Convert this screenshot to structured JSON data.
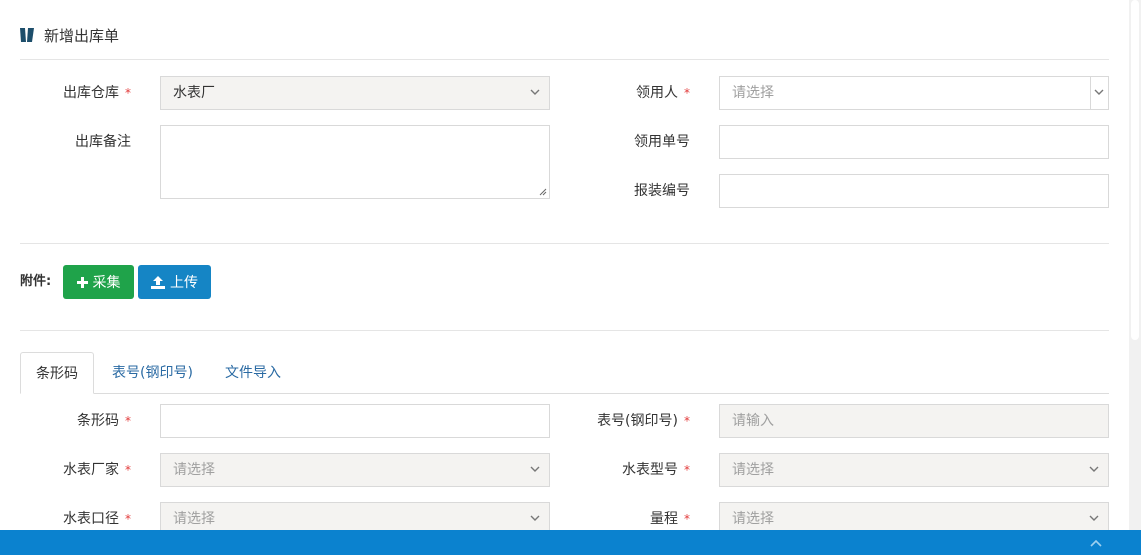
{
  "header": {
    "title": "新增出库单"
  },
  "form": {
    "warehouse": {
      "label": "出库仓库",
      "value": "水表厂"
    },
    "recipient": {
      "label": "领用人",
      "placeholder": "请选择"
    },
    "remark": {
      "label": "出库备注",
      "value": ""
    },
    "requisition_no": {
      "label": "领用单号",
      "value": ""
    },
    "install_no": {
      "label": "报装编号",
      "value": ""
    }
  },
  "attachments": {
    "label": "附件:",
    "collect_label": "采集",
    "upload_label": "上传"
  },
  "tabs": [
    {
      "label": "条形码",
      "active": true
    },
    {
      "label": "表号(钢印号)",
      "active": false
    },
    {
      "label": "文件导入",
      "active": false
    }
  ],
  "tab_form": {
    "barcode": {
      "label": "条形码",
      "value": ""
    },
    "meter_no": {
      "label": "表号(钢印号)",
      "placeholder": "请输入"
    },
    "manufacturer": {
      "label": "水表厂家",
      "placeholder": "请选择"
    },
    "model": {
      "label": "水表型号",
      "placeholder": "请选择"
    },
    "caliber": {
      "label": "水表口径",
      "placeholder": "请选择"
    },
    "range": {
      "label": "量程",
      "placeholder": "请选择"
    }
  },
  "required_mark": "*",
  "colors": {
    "accent_blue": "#1585c5",
    "accent_green": "#1fa34a",
    "footer": "#0b82cf",
    "required": "#e23a3a"
  }
}
